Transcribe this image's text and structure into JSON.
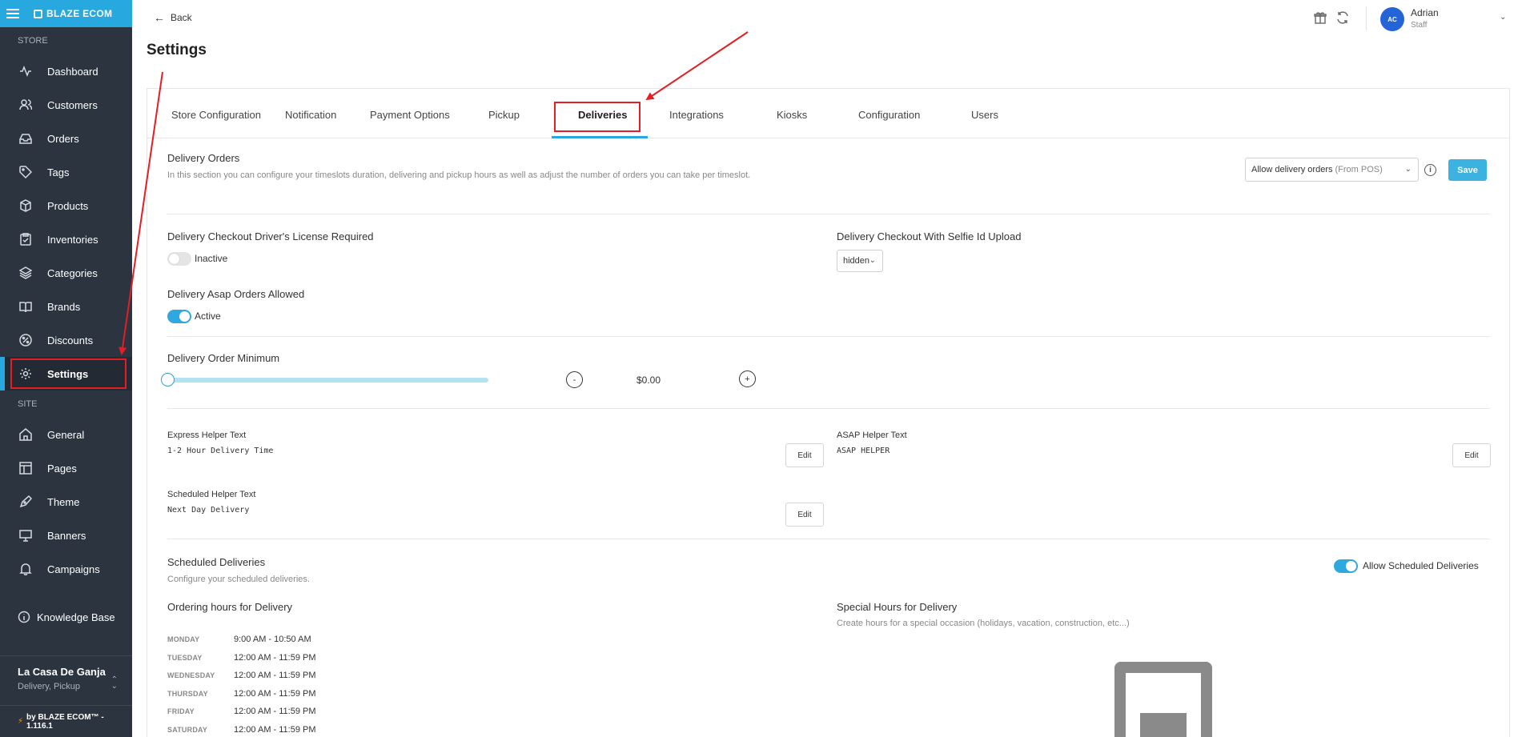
{
  "sidebar": {
    "brand": "BLAZE ECOM",
    "store_section": "STORE",
    "site_section": "SITE",
    "items": [
      {
        "label": "Dashboard",
        "icon": "activity-icon"
      },
      {
        "label": "Customers",
        "icon": "users-icon"
      },
      {
        "label": "Orders",
        "icon": "inbox-icon"
      },
      {
        "label": "Tags",
        "icon": "tag-icon"
      },
      {
        "label": "Products",
        "icon": "package-icon"
      },
      {
        "label": "Inventories",
        "icon": "clipboard-icon"
      },
      {
        "label": "Categories",
        "icon": "layers-icon"
      },
      {
        "label": "Brands",
        "icon": "book-icon"
      },
      {
        "label": "Discounts",
        "icon": "percent-icon"
      },
      {
        "label": "Settings",
        "icon": "gear-icon"
      }
    ],
    "site_items": [
      {
        "label": "General",
        "icon": "home-icon"
      },
      {
        "label": "Pages",
        "icon": "layout-icon"
      },
      {
        "label": "Theme",
        "icon": "pen-icon"
      },
      {
        "label": "Banners",
        "icon": "monitor-icon"
      },
      {
        "label": "Campaigns",
        "icon": "bell-icon"
      }
    ],
    "knowledge_base": "Knowledge Base",
    "store_name": "La Casa De Ganja",
    "store_sub": "Delivery, Pickup",
    "version": "by BLAZE ECOM™ - 1.116.1"
  },
  "header": {
    "back_label": "Back",
    "title": "Settings",
    "user_initials": "AC",
    "user_name": "Adrian",
    "user_role": "Staff"
  },
  "tabs": [
    "Store Configuration",
    "Notification",
    "Payment Options",
    "Pickup",
    "Deliveries",
    "Integrations",
    "Kiosks",
    "Configuration",
    "Users"
  ],
  "active_tab": "Deliveries",
  "delivery_orders": {
    "title": "Delivery Orders",
    "description": "In this section you can configure your timeslots duration, delivering and pickup hours as well as adjust the number of orders you can take per timeslot.",
    "select_value": "Allow delivery orders",
    "select_value_suffix": "(From POS)",
    "save_label": "Save"
  },
  "license": {
    "title": "Delivery Checkout Driver's License Required",
    "state_label": "Inactive",
    "enabled": false
  },
  "selfie": {
    "title": "Delivery Checkout With Selfie Id Upload",
    "select_value": "hidden"
  },
  "asap": {
    "title": "Delivery Asap Orders Allowed",
    "state_label": "Active",
    "enabled": true
  },
  "order_minimum": {
    "title": "Delivery Order Minimum",
    "minus": "-",
    "plus": "+",
    "amount": "$0.00",
    "slider_value": 0
  },
  "helper_texts": {
    "express_label": "Express Helper Text",
    "express_value": "1-2 Hour Delivery Time",
    "asap_label": "ASAP Helper Text",
    "asap_value": "ASAP HELPER",
    "scheduled_label": "Scheduled Helper Text",
    "scheduled_value": "Next Day Delivery",
    "edit_label": "Edit"
  },
  "scheduled_deliveries": {
    "title": "Scheduled Deliveries",
    "description": "Configure your scheduled deliveries.",
    "toggle_label": "Allow Scheduled Deliveries",
    "enabled": true
  },
  "ordering_hours": {
    "title": "Ordering hours for Delivery",
    "rows": [
      {
        "day": "MONDAY",
        "hours": "9:00 AM - 10:50 AM"
      },
      {
        "day": "TUESDAY",
        "hours": "12:00 AM - 11:59 PM"
      },
      {
        "day": "WEDNESDAY",
        "hours": "12:00 AM - 11:59 PM"
      },
      {
        "day": "THURSDAY",
        "hours": "12:00 AM - 11:59 PM"
      },
      {
        "day": "FRIDAY",
        "hours": "12:00 AM - 11:59 PM"
      },
      {
        "day": "SATURDAY",
        "hours": "12:00 AM - 11:59 PM"
      }
    ]
  },
  "special_hours": {
    "title": "Special Hours for Delivery",
    "description": "Create hours for a special occasion (holidays, vacation, construction, etc...)",
    "empty_icon": "inbox-empty-icon"
  },
  "colors": {
    "accent": "#27a9df",
    "sidebar_bg": "#2c3440",
    "annotation": "#e31e24"
  }
}
